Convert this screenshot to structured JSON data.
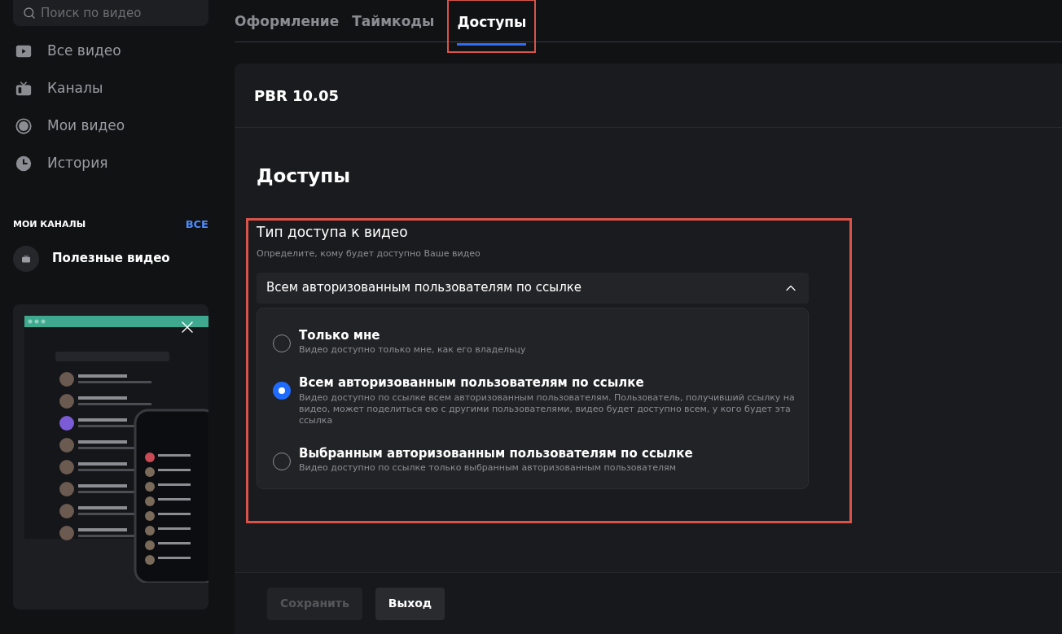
{
  "sidebar": {
    "search": {
      "placeholder": "Поиск по видео"
    },
    "nav": [
      {
        "label": "Все видео"
      },
      {
        "label": "Каналы"
      },
      {
        "label": "Мои видео"
      },
      {
        "label": "История"
      }
    ],
    "my_channels": {
      "title": "МОИ КАНАЛЫ",
      "link": "ВСЕ",
      "items": [
        {
          "name": "Полезные видео"
        }
      ]
    }
  },
  "tabs": [
    {
      "label": "Оформление",
      "selected": false
    },
    {
      "label": "Таймкоды",
      "selected": false
    },
    {
      "label": "Доступы",
      "selected": true
    }
  ],
  "panel": {
    "title": "PBR 10.05",
    "section_title": "Доступы",
    "access": {
      "title": "Тип доступа к видео",
      "hint": "Определите, кому будет доступно Ваше видео",
      "dropdown": {
        "value": "Всем авторизованным пользователям по ссылке",
        "expanded": true
      },
      "options": [
        {
          "title": "Только мне",
          "description": "Видео доступно только мне, как его владельцу",
          "selected": false
        },
        {
          "title": "Всем авторизованным пользователям по ссылке",
          "description": "Видео доступно по ссылке всем авторизованным пользователям. Пользователь, получивший ссылку на видео, может поделиться ею с другими пользователями, видео будет доступно всем, у кого будет эта ссылка",
          "selected": true
        },
        {
          "title": "Выбранным авторизованным пользователям по ссылке",
          "description": "Видео доступно по ссылке только выбранным авторизованным пользователям",
          "selected": false
        }
      ]
    },
    "buttons": [
      {
        "label": "Сохранить",
        "disabled": true
      },
      {
        "label": "Выход",
        "disabled": false
      }
    ]
  }
}
